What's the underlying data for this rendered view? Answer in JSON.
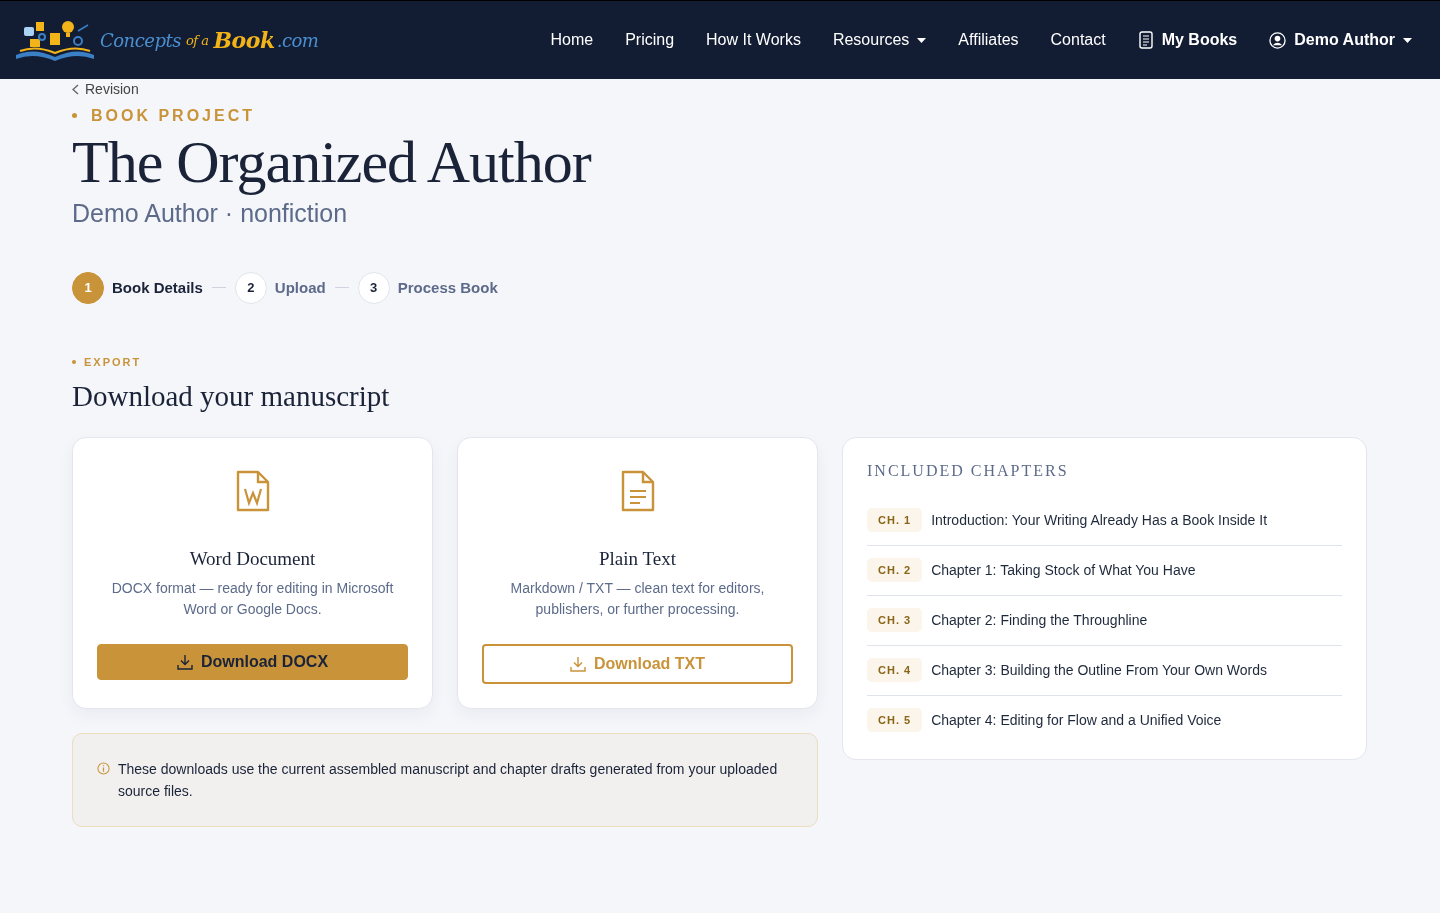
{
  "logo": {
    "parts": [
      {
        "text": "Concepts",
        "kind": "blue"
      },
      {
        "text": "of a",
        "kind": "gold"
      },
      {
        "text": "Book",
        "kind": "gold"
      },
      {
        "text": ".com",
        "kind": "blue"
      }
    ]
  },
  "nav": {
    "items": [
      {
        "label": "Home",
        "kind": "link"
      },
      {
        "label": "Pricing",
        "kind": "link"
      },
      {
        "label": "How It Works",
        "kind": "link"
      },
      {
        "label": "Resources",
        "kind": "dropdown"
      },
      {
        "label": "Affiliates",
        "kind": "link"
      },
      {
        "label": "Contact",
        "kind": "link"
      },
      {
        "label": "My Books",
        "kind": "books"
      },
      {
        "label": "Demo Author",
        "kind": "user"
      }
    ]
  },
  "back_link": "Revision",
  "eyebrow": "BOOK PROJECT",
  "title": "The Organized Author",
  "subtitle": "Demo Author · nonfiction",
  "steps": [
    {
      "number": "1",
      "label": "Book Details",
      "selected": true
    },
    {
      "number": "2",
      "label": "Upload",
      "selected": false
    },
    {
      "number": "3",
      "label": "Process Book",
      "selected": false
    }
  ],
  "section_label": "EXPORT",
  "section_title": "Download your manuscript",
  "cards": [
    {
      "kind": "word",
      "title": "Word Document",
      "description": "DOCX format — ready for editing in Microsoft Word or Google Docs.",
      "button": {
        "label": "Download DOCX",
        "kind": "solid"
      }
    },
    {
      "kind": "text",
      "title": "Plain Text",
      "description": "Markdown / TXT — clean text for editors, publishers, or further processing.",
      "button": {
        "label": "Download TXT",
        "kind": "outline"
      }
    }
  ],
  "note": "These downloads use the current assembled manuscript and chapter drafts generated from your uploaded source files.",
  "chapters": {
    "title": "INCLUDED CHAPTERS",
    "items": [
      {
        "tag": "CH. 1",
        "title": "Introduction: Your Writing Already Has a Book Inside It"
      },
      {
        "tag": "CH. 2",
        "title": "Chapter 1: Taking Stock of What You Have"
      },
      {
        "tag": "CH. 3",
        "title": "Chapter 2: Finding the Throughline"
      },
      {
        "tag": "CH. 4",
        "title": "Chapter 3: Building the Outline From Your Own Words"
      },
      {
        "tag": "CH. 5",
        "title": "Chapter 4: Editing for Flow and a Unified Voice"
      }
    ]
  }
}
